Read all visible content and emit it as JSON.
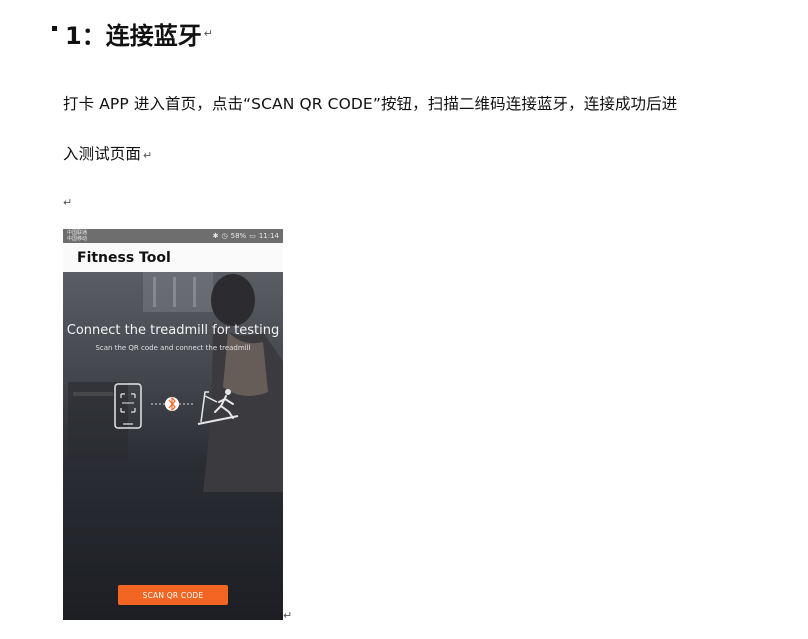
{
  "heading": {
    "text": "1：连接蓝牙",
    "mark": "↵"
  },
  "body": {
    "line1": "打卡 APP 进入首页，点击“SCAN QR CODE”按钮，扫描二维码连接蓝牙，连接成功后进",
    "line2": "入测试页面",
    "mark": "↵"
  },
  "phone": {
    "status": {
      "carrier1": "中国联通",
      "carrier2": "中国移动",
      "battery": "58%",
      "time": "11:14"
    },
    "app_title": "Fitness Tool",
    "hero_title": "Connect the treadmill for testing",
    "hero_subtitle": "Scan the QR code and connect the treadmill",
    "scan_button": "SCAN QR CODE",
    "accent": "#f26522"
  },
  "icons": [
    "phone-qr-icon",
    "bluetooth-icon",
    "treadmill-runner-icon"
  ]
}
